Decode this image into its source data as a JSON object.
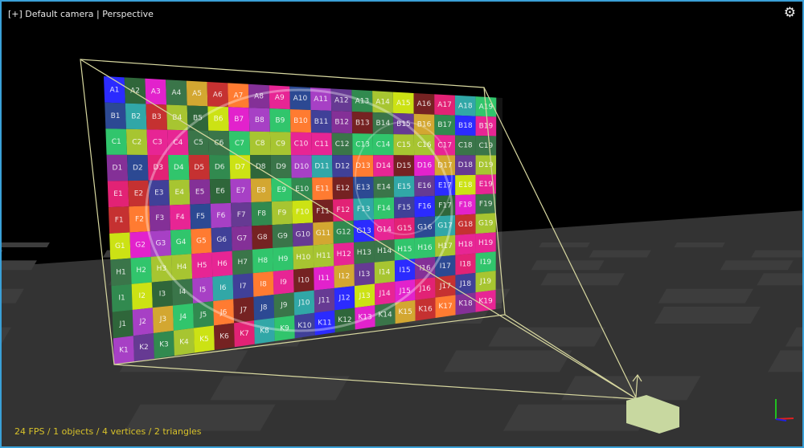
{
  "viewport": {
    "camera_label": "[+] Default camera | Perspective",
    "settings_icon": "gear-icon",
    "stats": "24 FPS / 1 objects / 4 vertices / 2 triangles"
  },
  "texture_grid": {
    "rows": [
      "A",
      "B",
      "C",
      "D",
      "E",
      "F",
      "G",
      "H",
      "I",
      "J",
      "K"
    ],
    "columns": 19,
    "palette": [
      "#1a1aff",
      "#7a1f8f",
      "#c8e000",
      "#1e5a2a",
      "#e5138b",
      "#6a1010",
      "#e010c8",
      "#1b3a8a",
      "#e0106a",
      "#2a6a3a",
      "#a030c0",
      "#20a0a0",
      "#d0a020",
      "#5a2a8a",
      "#20c060",
      "#c02020",
      "#208040",
      "#303090",
      "#ff7020",
      "#a0c020"
    ]
  },
  "colors": {
    "frustum": "#d8d8a0",
    "camera_body": "#c8d8a0",
    "floor_dark": "#333333",
    "floor_light": "#3d3d3d",
    "axis_x": "#e02020",
    "axis_y": "#20c020",
    "axis_z": "#2020e0"
  }
}
